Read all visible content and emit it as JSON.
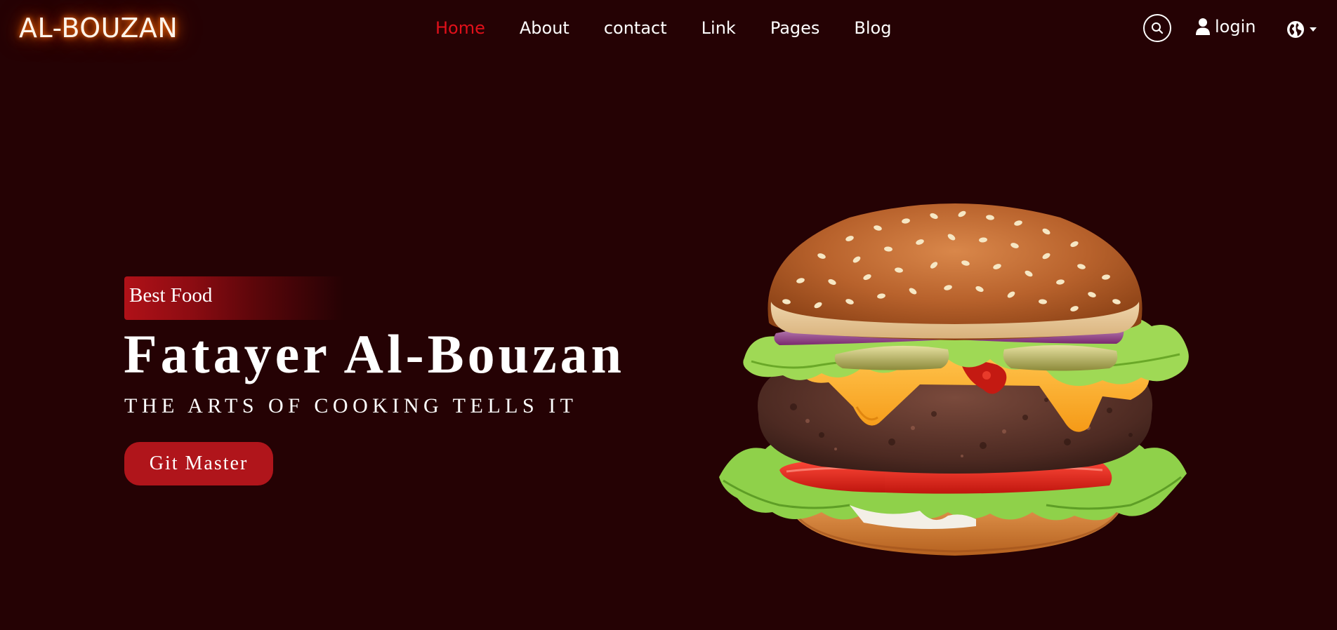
{
  "brand": {
    "name": "AL-BOUZAN"
  },
  "nav": {
    "items": [
      {
        "label": "Home",
        "active": true
      },
      {
        "label": "About",
        "active": false
      },
      {
        "label": "contact",
        "active": false
      },
      {
        "label": "Link",
        "active": false
      },
      {
        "label": "Pages",
        "active": false
      },
      {
        "label": "Blog",
        "active": false
      }
    ],
    "search_icon": "search-icon",
    "login": {
      "icon": "user-icon",
      "label": "login"
    },
    "language": {
      "icon": "globe-icon",
      "caret": "caret-down-icon"
    }
  },
  "hero": {
    "badge": "Best Food",
    "title": "Fatayer Al-Bouzan",
    "subtitle": "THE ARTS OF COOKING TELLS IT",
    "cta_label": "Git Master",
    "image": "burger-image"
  },
  "colors": {
    "background": "#250204",
    "accent": "#b0151b",
    "active_link": "#e0101a",
    "brand_glow": "#ff6a00"
  }
}
